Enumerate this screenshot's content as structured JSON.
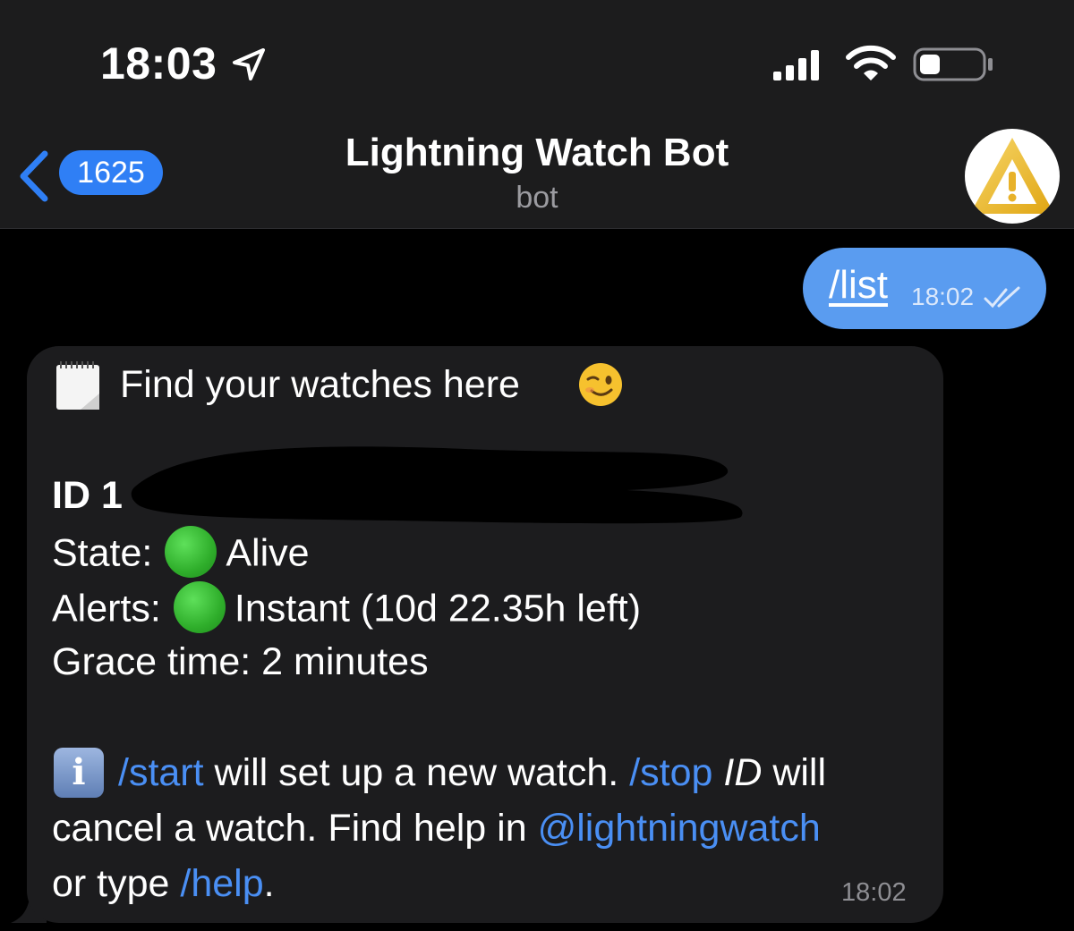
{
  "status_bar": {
    "time": "18:03",
    "location_icon": "location-arrow-icon",
    "signal_icon": "cellular-signal-icon",
    "wifi_icon": "wifi-icon",
    "battery_icon": "battery-icon"
  },
  "nav": {
    "back_icon": "chevron-left-icon",
    "unread_count": "1625",
    "title": "Lightning Watch Bot",
    "subtitle": "bot",
    "avatar_icon": "warning-triangle-icon"
  },
  "outgoing_message": {
    "text": "/list",
    "time": "18:02",
    "status_icon": "double-check-icon"
  },
  "incoming_message": {
    "header_icon": "notepad-icon",
    "header": "Find your watches here",
    "header_emoji": "winking-face-icon",
    "id_prefix": "ID 1",
    "state_label": "State:",
    "state_value": "Alive",
    "alerts_label": "Alerts:",
    "alerts_value": "Instant (10d 22.35h left)",
    "grace_time": "Grace time: 2 minutes",
    "info_icon": "information-icon",
    "info_letter": "i",
    "start_cmd": "/start",
    "text_1": " will set up a new watch. ",
    "stop_cmd": "/stop",
    "stop_arg": " ID",
    "text_2": " will",
    "text_3": "cancel a watch. Find help in ",
    "handle": "@lightningwatch",
    "text_4": "or type ",
    "help_cmd": "/help",
    "text_5": ".",
    "time": "18:02",
    "colors": {
      "link": "#4a8ff4",
      "alive": "#2fae2b"
    }
  }
}
